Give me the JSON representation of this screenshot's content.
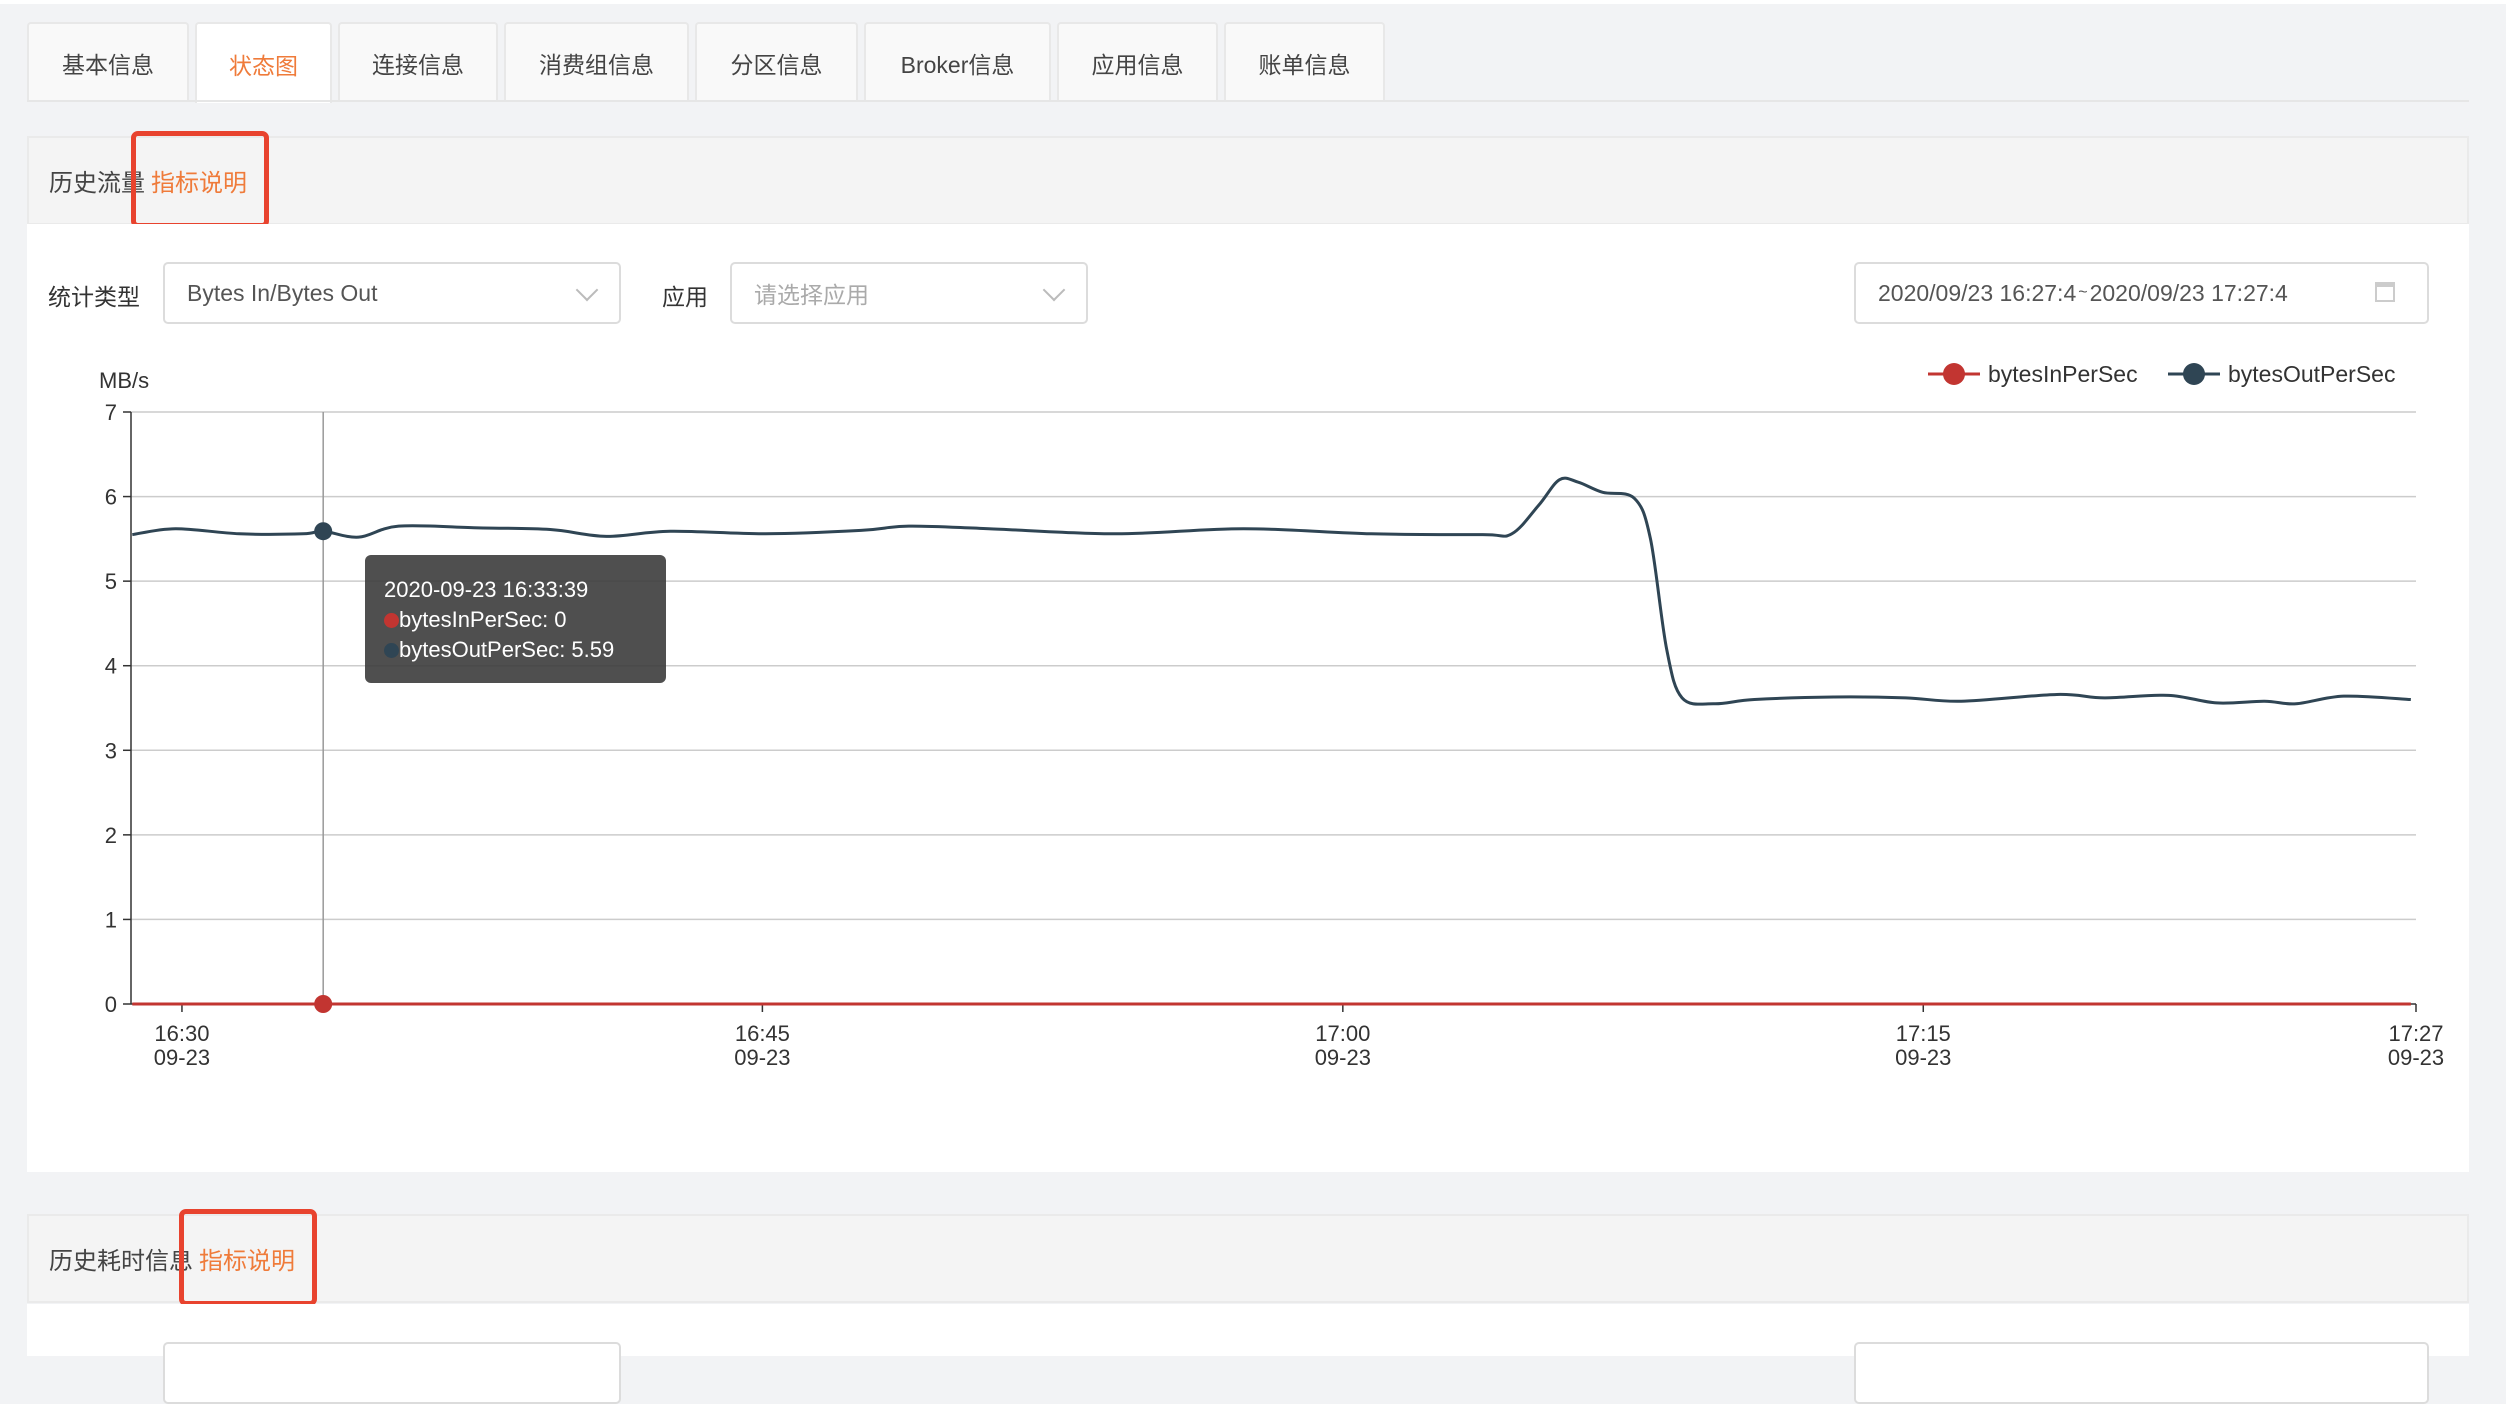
{
  "tabs": [
    {
      "label": "基本信息"
    },
    {
      "label": "状态图",
      "active": true
    },
    {
      "label": "连接信息"
    },
    {
      "label": "消费组信息"
    },
    {
      "label": "分区信息"
    },
    {
      "label": "Broker信息"
    },
    {
      "label": "应用信息"
    },
    {
      "label": "账单信息"
    }
  ],
  "section1": {
    "title": "历史流量",
    "link": "指标说明"
  },
  "filters": {
    "stat_type_label": "统计类型",
    "stat_type_value": "Bytes In/Bytes Out",
    "app_label": "应用",
    "app_placeholder": "请选择应用",
    "date_range": "2020/09/23 16:27:44 ~ 2020/09/23 17:27:44",
    "date_start": "2020/09/23 16:27:4",
    "date_sep": "~",
    "date_end": "2020/09/23 17:27:4",
    "calendar_icon": "calendar-icon"
  },
  "tooltip": {
    "time": "2020-09-23 16:33:39",
    "in_label": "bytesInPerSec: 0",
    "out_label": "bytesOutPerSec: 5.59"
  },
  "section2": {
    "title": "历史耗时信息",
    "link": "指标说明"
  },
  "colors": {
    "accent": "#ef7b3a",
    "bytesIn": "#c23531",
    "bytesOut": "#2f4554",
    "highlight": "#e8432e"
  },
  "chart_data": {
    "type": "line",
    "ylabel": "MB/s",
    "ylim": [
      0,
      7
    ],
    "yticks": [
      "0",
      "1",
      "2",
      "3",
      "4",
      "5",
      "6",
      "7"
    ],
    "xlim": [
      "16:28:41",
      "17:27:44"
    ],
    "xticks": [
      {
        "time": "16:30",
        "l1": "16:30",
        "l2": "09-23"
      },
      {
        "time": "16:45",
        "l1": "16:45",
        "l2": "09-23"
      },
      {
        "time": "17:00",
        "l1": "17:00",
        "l2": "09-23"
      },
      {
        "time": "17:15",
        "l1": "17:15",
        "l2": "09-23"
      },
      {
        "time": "17:27:44",
        "l1": "17:27",
        "l2": "09-23"
      }
    ],
    "grid": true,
    "legend": "top-right",
    "x": [
      "16:28:43",
      "16:29:50",
      "16:31:29",
      "16:33:08",
      "16:33:39",
      "16:34:34",
      "16:35:36",
      "16:37:40",
      "16:39:31",
      "16:40:58",
      "16:42:37",
      "16:45:05",
      "16:47:33",
      "16:48:47",
      "16:50:51",
      "16:54:08",
      "16:57:26",
      "17:00:44",
      "17:03:37",
      "17:04:22",
      "17:05:04",
      "17:05:36",
      "17:06:05",
      "17:06:43",
      "17:07:32",
      "17:07:57",
      "17:08:22",
      "17:08:46",
      "17:09:36",
      "17:10:38",
      "17:12:41",
      "17:14:33",
      "17:15:59",
      "17:18:27",
      "17:19:41",
      "17:21:20",
      "17:22:35",
      "17:23:49",
      "17:24:38",
      "17:25:52",
      "17:27:36"
    ],
    "series": [
      {
        "name": "bytesInPerSec",
        "values": [
          0,
          0,
          0,
          0,
          0,
          0,
          0,
          0,
          0,
          0,
          0,
          0,
          0,
          0,
          0,
          0,
          0,
          0,
          0,
          0,
          0,
          0,
          0,
          0,
          0,
          0,
          0,
          0,
          0,
          0,
          0,
          0,
          0,
          0,
          0,
          0,
          0,
          0,
          0,
          0,
          0
        ]
      },
      {
        "name": "bytesOutPerSec",
        "values": [
          5.55,
          5.62,
          5.56,
          5.56,
          5.59,
          5.52,
          5.65,
          5.63,
          5.61,
          5.53,
          5.59,
          5.56,
          5.6,
          5.65,
          5.62,
          5.56,
          5.62,
          5.56,
          5.55,
          5.56,
          5.9,
          6.2,
          6.17,
          6.05,
          5.98,
          5.5,
          4.2,
          3.62,
          3.55,
          3.6,
          3.63,
          3.62,
          3.58,
          3.66,
          3.62,
          3.65,
          3.56,
          3.58,
          3.55,
          3.64,
          3.6
        ]
      }
    ],
    "highlight_time": "16:33:39"
  }
}
